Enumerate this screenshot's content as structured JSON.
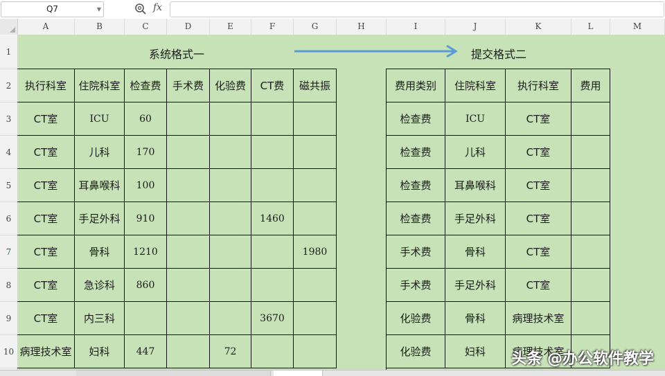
{
  "name_box": "Q7",
  "fx_label": "fx",
  "columns": [
    "A",
    "B",
    "C",
    "D",
    "E",
    "F",
    "G",
    "H",
    "I",
    "J",
    "K",
    "L",
    "M"
  ],
  "rows": [
    "1",
    "2",
    "3",
    "4",
    "5",
    "6",
    "7",
    "8",
    "9",
    "10"
  ],
  "active_row": "7",
  "title_left": "系统格式一",
  "title_right": "提交格式二",
  "left_table": {
    "headers": [
      "执行科室",
      "住院科室",
      "检查费",
      "手术费",
      "化验费",
      "CT费",
      "磁共振"
    ],
    "rows": [
      [
        "CT室",
        "ICU",
        "60",
        "",
        "",
        "",
        ""
      ],
      [
        "CT室",
        "儿科",
        "170",
        "",
        "",
        "",
        ""
      ],
      [
        "CT室",
        "耳鼻喉科",
        "100",
        "",
        "",
        "",
        ""
      ],
      [
        "CT室",
        "手足外科",
        "910",
        "",
        "",
        "1460",
        ""
      ],
      [
        "CT室",
        "骨科",
        "1210",
        "",
        "",
        "",
        "1980"
      ],
      [
        "CT室",
        "急诊科",
        "860",
        "",
        "",
        "",
        ""
      ],
      [
        "CT室",
        "内三科",
        "",
        "",
        "",
        "3670",
        ""
      ],
      [
        "病理技术室",
        "妇科",
        "447",
        "",
        "72",
        "",
        ""
      ]
    ]
  },
  "right_table": {
    "headers": [
      "费用类别",
      "住院科室",
      "执行科室",
      "费用"
    ],
    "rows": [
      [
        "检查费",
        "ICU",
        "CT室",
        ""
      ],
      [
        "检查费",
        "儿科",
        "CT室",
        ""
      ],
      [
        "检查费",
        "耳鼻喉科",
        "CT室",
        ""
      ],
      [
        "检查费",
        "手足外科",
        "CT室",
        ""
      ],
      [
        "手术费",
        "骨科",
        "CT室",
        ""
      ],
      [
        "手术费",
        "手足外科",
        "CT室",
        ""
      ],
      [
        "化验费",
        "骨科",
        "病理技术室",
        ""
      ],
      [
        "化验费",
        "妇科",
        "病理技术室",
        ""
      ]
    ]
  },
  "watermark": "头条 @办公软件教学",
  "colors": {
    "sheet_bg": "#c8e2b8",
    "arrow": "#5b9bd5",
    "grid": "#111111"
  }
}
